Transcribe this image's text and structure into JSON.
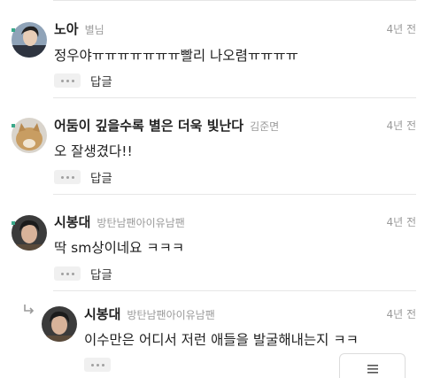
{
  "comments": [
    {
      "author": "노아",
      "tag": "별님",
      "time": "4년 전",
      "text": "정우야ㅠㅠㅠㅠㅠㅠㅠ빨리 나오렴ㅠㅠㅠㅠ",
      "reply_label": "답글"
    },
    {
      "author": "어둠이 깊을수록 별은 더욱 빛난다",
      "tag": "김준면",
      "time": "4년 전",
      "text": "오 잘생겼다!!",
      "reply_label": "답글"
    },
    {
      "author": "시봉대",
      "tag": "방탄남팬아이유남팬",
      "time": "4년 전",
      "text": "딱 sm상이네요 ㅋㅋㅋ",
      "reply_label": "답글"
    },
    {
      "author": "시봉대",
      "tag": "방탄남팬아이유남팬",
      "time": "4년 전",
      "text": "이수만은 어디서 저런 애들을 발굴해내는지 ㅋㅋ",
      "is_reply": true
    }
  ],
  "colors": {
    "text": "#1f1f1f",
    "meta": "#9a9a9a",
    "divider": "#e6e6e6",
    "pin": "#3aa88a"
  },
  "icons": {
    "more": "more-dots-icon",
    "reply": "reply-arrow-icon",
    "menu": "hamburger-menu-icon",
    "pin": "pin-dot-icon"
  }
}
